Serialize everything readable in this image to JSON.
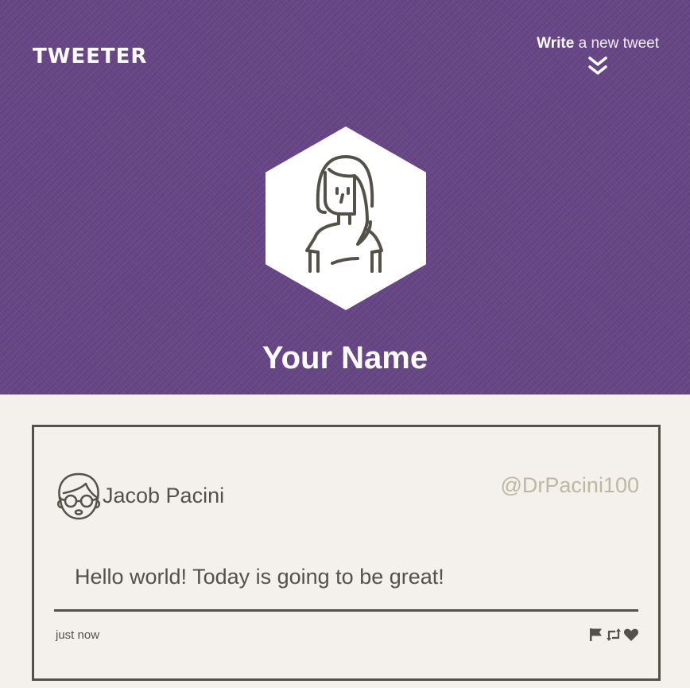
{
  "header": {
    "logo": "TWEETER",
    "compose": {
      "bold": "Write",
      "rest": " a new tweet",
      "icon": "double-chevron-down-icon"
    },
    "avatar_icon": "woman-avatar-icon",
    "profile_name": "Your Name",
    "background_color": "#674486"
  },
  "tweets": [
    {
      "avatar_icon": "man-with-glasses-avatar-icon",
      "author": "Jacob Pacini",
      "handle": "@DrPacini100",
      "text": "Hello world! Today is going to be great!",
      "time": "just now",
      "actions": [
        "flag-icon",
        "retweet-icon",
        "heart-icon"
      ]
    }
  ],
  "colors": {
    "page_bg": "#f4f1ec",
    "text": "#545149",
    "handle": "#bdb7a3"
  }
}
